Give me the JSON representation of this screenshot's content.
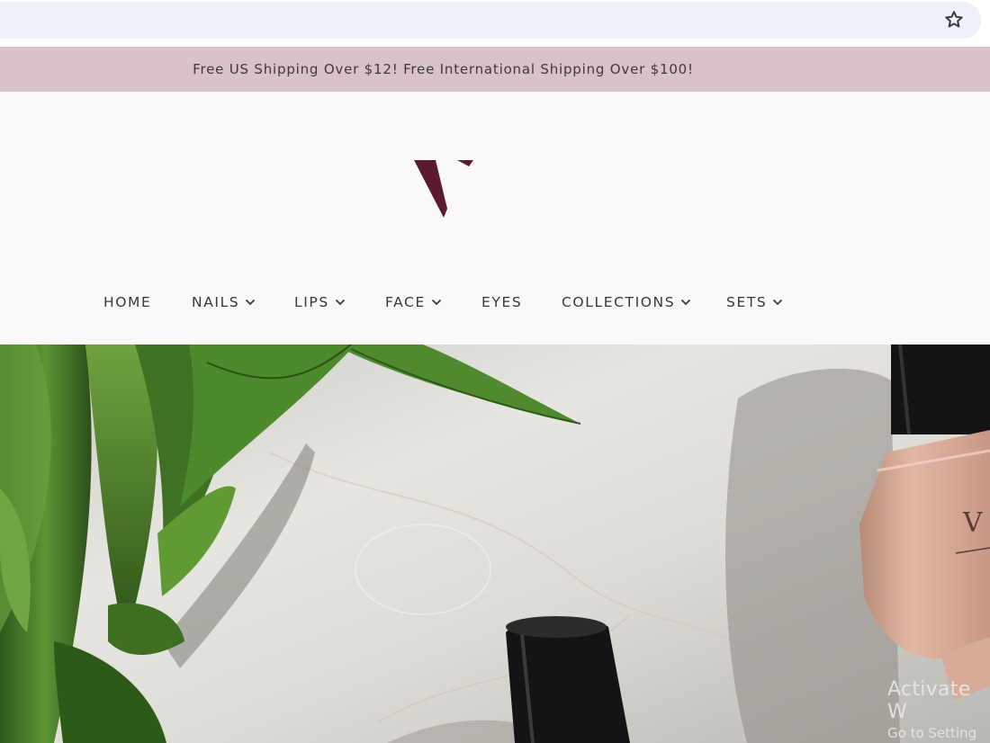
{
  "browser": {
    "bookmark_icon": "star-outline-icon"
  },
  "announcement": {
    "text": "Free US Shipping Over $12! Free International Shipping Over $100!"
  },
  "brand": {
    "logo_letter": "V",
    "color": "#5c1a33"
  },
  "nav": {
    "items": [
      {
        "label": "HOME",
        "has_dropdown": false
      },
      {
        "label": "NAILS",
        "has_dropdown": true
      },
      {
        "label": "LIPS",
        "has_dropdown": true
      },
      {
        "label": "FACE",
        "has_dropdown": true
      },
      {
        "label": "EYES",
        "has_dropdown": false
      },
      {
        "label": "COLLECTIONS",
        "has_dropdown": true
      },
      {
        "label": "SETS",
        "has_dropdown": true
      }
    ],
    "dropdown_icon": "chevron-down-icon"
  },
  "hero": {
    "image": "nail polish bottles and green plant on marble surface",
    "bottle_logo": "V"
  },
  "system_watermark": {
    "title": "Activate W",
    "subtitle": "Go to Setting"
  },
  "colors": {
    "announcement_bg": "#d8c3c8",
    "header_bg": "#fbf8fb",
    "nav_text": "#3a3738",
    "address_bar": "#eef0fa"
  }
}
